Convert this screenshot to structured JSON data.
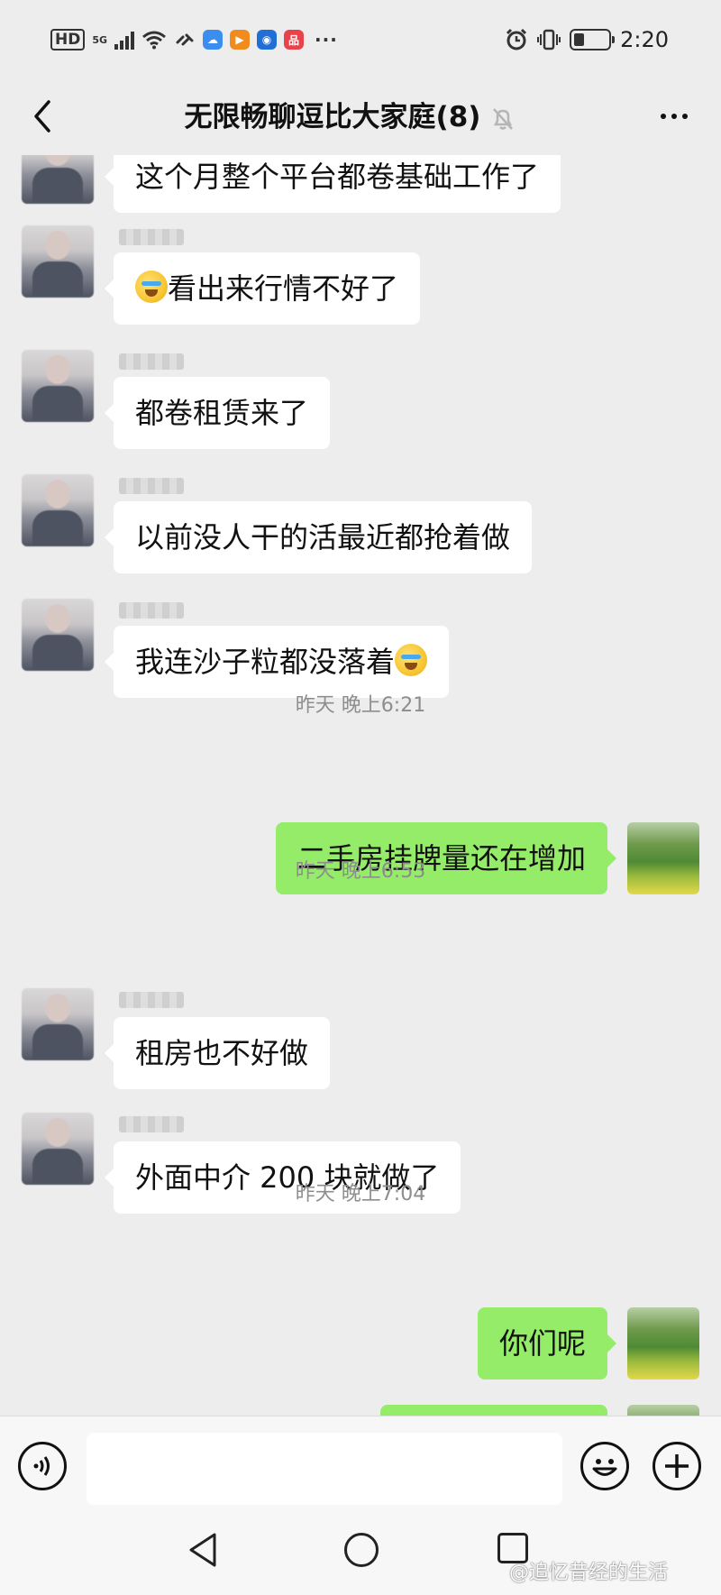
{
  "status_bar": {
    "hd": "HD",
    "net": "5G",
    "more": "···",
    "time": "2:20",
    "battery_level": 0.3,
    "app_icons": [
      {
        "name": "cloud-app-icon",
        "color": "#3a8ef0",
        "glyph": "☁"
      },
      {
        "name": "video-app-icon",
        "color": "#f28b1d",
        "glyph": "▶"
      },
      {
        "name": "bank-app-icon",
        "color": "#1f6fd6",
        "glyph": "◉"
      },
      {
        "name": "shop-app-icon",
        "color": "#e8424a",
        "glyph": "品"
      }
    ]
  },
  "header": {
    "title": "无限畅聊逗比大家庭(8)",
    "back_icon": "chevron-left-icon",
    "mute_icon": "bell-off-icon",
    "more_icon": "more-dots-icon"
  },
  "messages": [
    {
      "side": "left",
      "text": "这个月整个平台都卷基础工作了",
      "emoji": false
    },
    {
      "side": "left",
      "text": "看出来行情不好了",
      "emoji": "before"
    },
    {
      "side": "left",
      "text": "都卷租赁来了",
      "emoji": false
    },
    {
      "side": "left",
      "text": "以前没人干的活最近都抢着做",
      "emoji": false
    },
    {
      "side": "left",
      "text": "我连沙子粒都没落着",
      "emoji": "after"
    },
    {
      "side": "time",
      "text": "昨天 晚上6:21"
    },
    {
      "side": "right",
      "text": "二手房挂牌量还在增加"
    },
    {
      "side": "time",
      "text": "昨天 晚上6:53"
    },
    {
      "side": "left",
      "text": "租房也不好做",
      "emoji": false
    },
    {
      "side": "left",
      "text": "外面中介 200 块就做了",
      "emoji": false
    },
    {
      "side": "time",
      "text": "昨天 晚上7:04"
    },
    {
      "side": "right",
      "text": "你们呢"
    },
    {
      "side": "right",
      "text": ""
    }
  ],
  "input_bar": {
    "voice_icon": "voice-icon",
    "emoji_icon": "smile-icon",
    "plus_icon": "plus-icon",
    "input_value": ""
  },
  "nav": {
    "back_icon": "nav-back-icon",
    "home_icon": "nav-home-icon",
    "recent_icon": "nav-recent-icon",
    "watermark": "@追忆昔经的生活"
  },
  "colors": {
    "background": "#ededed",
    "bubble_left": "#ffffff",
    "bubble_right": "#95ec69"
  }
}
